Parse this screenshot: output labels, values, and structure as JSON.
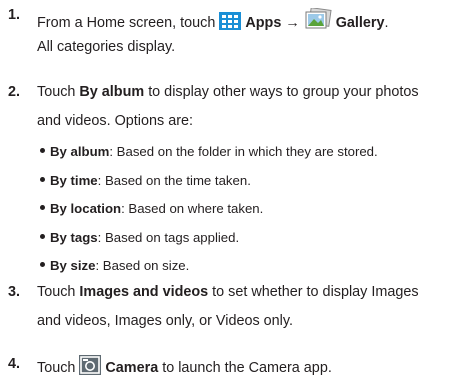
{
  "steps": [
    {
      "number": "1.",
      "line1": {
        "pre": "From a Home screen, touch",
        "apps": "Apps",
        "arrow": "→",
        "gallery": "Gallery",
        "post": "."
      },
      "line2": "All categories display."
    },
    {
      "number": "2.",
      "line1": {
        "pre": "Touch",
        "bold": "By album",
        "post": "to display other ways to group your photos"
      },
      "line2": "and videos. Options are:",
      "options": [
        {
          "label": "By album",
          "desc": ": Based on the folder in which they are stored."
        },
        {
          "label": "By time",
          "desc": ": Based on the time taken."
        },
        {
          "label": "By location",
          "desc": ": Based on where taken."
        },
        {
          "label": "By tags",
          "desc": ": Based on tags applied."
        },
        {
          "label": "By size",
          "desc": ": Based on size."
        }
      ]
    },
    {
      "number": "3.",
      "line1": {
        "pre": "Touch",
        "bold": "Images and videos",
        "post": "to set whether to display Images"
      },
      "line2": "and videos, Images only, or Videos only."
    },
    {
      "number": "4.",
      "line1": {
        "pre": "Touch",
        "bold": "Camera",
        "post": "to launch the Camera app."
      }
    }
  ],
  "icons": {
    "apps": "apps-grid-icon",
    "gallery": "gallery-icon",
    "camera": "camera-icon"
  },
  "colors": {
    "text": "#231f20",
    "apps_icon": "#1a8fd6",
    "camera_icon": "#5f6a72"
  }
}
